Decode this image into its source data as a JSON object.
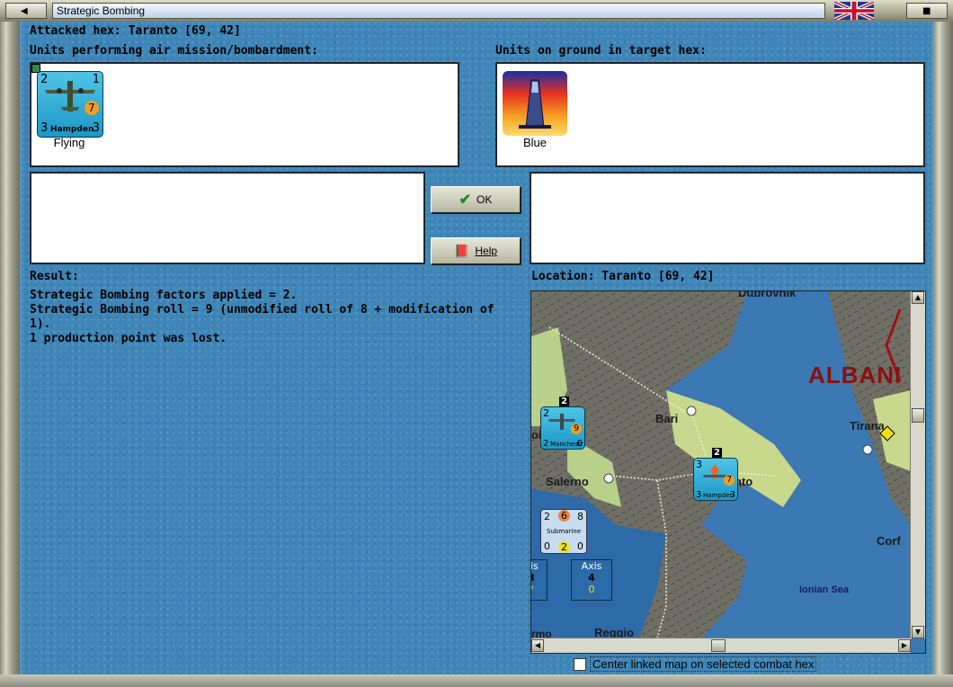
{
  "window": {
    "title": "Strategic Bombing"
  },
  "header": {
    "attacked_hex": "Attacked hex: Taranto  [69, 42]"
  },
  "left_panel": {
    "label": "Units performing air mission/bombardment:",
    "unit": {
      "name": "Hampden",
      "top_left": "2",
      "top_right": "1",
      "bottom_left": "3",
      "bottom_right": "3",
      "badge": "7",
      "caption": "Flying"
    }
  },
  "right_panel": {
    "label": "Units on ground in target hex:",
    "unit": {
      "caption": "Blue"
    }
  },
  "buttons": {
    "ok": "OK",
    "help": "Help"
  },
  "result": {
    "label": "Result:",
    "lines": [
      "Strategic Bombing factors applied = 2.",
      "Strategic Bombing roll = 9 (unmodified roll of 8 + modification of 1).",
      "1 production point was lost."
    ]
  },
  "location": {
    "label": "Location:  Taranto  [69, 42]"
  },
  "map": {
    "labels": {
      "albania": "ALBANI",
      "bari": "Bari",
      "tirana": "Tirana",
      "salerno": "Salerno",
      "taranto_partial": "nto",
      "corfu_partial": "Corf",
      "ionian": "Ionian Sea",
      "reggio": "Reggio",
      "partial_left": "ol",
      "partial_bottom": "rmo",
      "partial_top": "Dubrovnik"
    },
    "unit_manchester": {
      "name": "Manchestr",
      "stack": "2",
      "tl": "2",
      "bl": "2",
      "br": "0",
      "badge": "9"
    },
    "unit_hampden": {
      "name": "Hampden",
      "stack": "2",
      "tl": "3",
      "bl": "3",
      "br": "3",
      "badge": "7"
    },
    "submarine": {
      "name": "Submarine",
      "top": [
        "2",
        "6",
        "8"
      ],
      "bottom": [
        "0",
        "2",
        "0"
      ]
    },
    "axis_boxes": [
      {
        "title": "xis",
        "value": "3",
        "sub": "*"
      },
      {
        "title": "Axis",
        "value": "4",
        "sub": "0"
      }
    ]
  },
  "footer": {
    "center_linked_map": "Center linked map on selected combat hex"
  },
  "colors": {
    "sea": "#3f86b8",
    "map_sea": "#3b78b4",
    "counter": "#1c98c8",
    "albania_text": "#8b1010"
  }
}
